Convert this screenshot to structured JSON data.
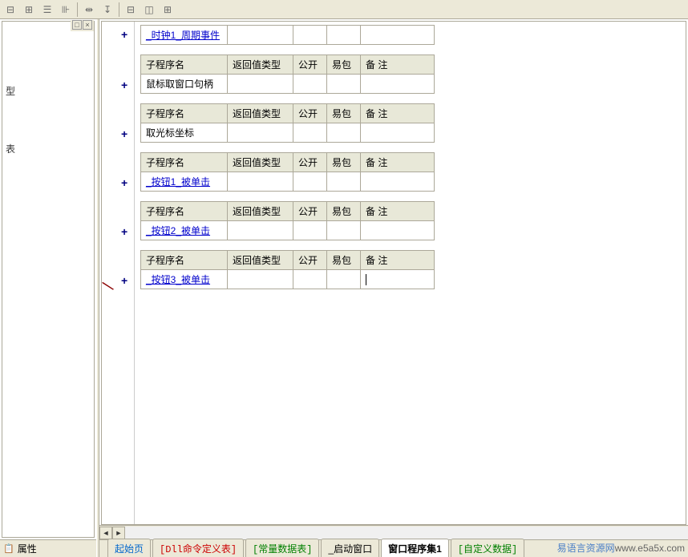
{
  "toolbar": {
    "icons": [
      "align-left-icon",
      "align-right-icon",
      "align-justify-icon",
      "align-center-icon",
      "arrow-both-icon",
      "arrow-down-icon",
      "split-h-icon",
      "split-v-icon",
      "grid-icon"
    ]
  },
  "left_panel": {
    "header_buttons": [
      "□",
      "×"
    ],
    "content_char1": "型",
    "content_char2": "表"
  },
  "properties": {
    "label": "属性",
    "icon": "📋"
  },
  "columns": {
    "name": "子程序名",
    "return_type": "返回值类型",
    "public": "公开",
    "pack": "易包",
    "note": "备 注"
  },
  "blocks": [
    {
      "name": "_时钟1_周期事件",
      "link": true,
      "header": false,
      "cursor": false
    },
    {
      "name": "鼠标取窗口句柄",
      "link": false,
      "header": true,
      "cursor": false
    },
    {
      "name": "取光标坐标",
      "link": false,
      "header": true,
      "cursor": false
    },
    {
      "name": "_按钮1_被单击",
      "link": true,
      "header": true,
      "cursor": false
    },
    {
      "name": "_按钮2_被单击",
      "link": true,
      "header": true,
      "cursor": false
    },
    {
      "name": "_按钮3_被单击",
      "link": true,
      "header": true,
      "cursor": true,
      "wand": true
    }
  ],
  "tabs": [
    {
      "label": "起始页",
      "style": "blue",
      "active": false
    },
    {
      "label": "[Dll命令定义表]",
      "style": "red",
      "active": false
    },
    {
      "label": "[常量数据表]",
      "style": "green",
      "active": false
    },
    {
      "label": "_启动窗口",
      "style": "plain",
      "active": false
    },
    {
      "label": "窗口程序集1",
      "style": "plain",
      "active": true
    },
    {
      "label": "[自定义数据]",
      "style": "green",
      "active": false
    }
  ],
  "watermark": {
    "cn": "易语言资源网",
    "url": "www.e5a5x.com"
  }
}
